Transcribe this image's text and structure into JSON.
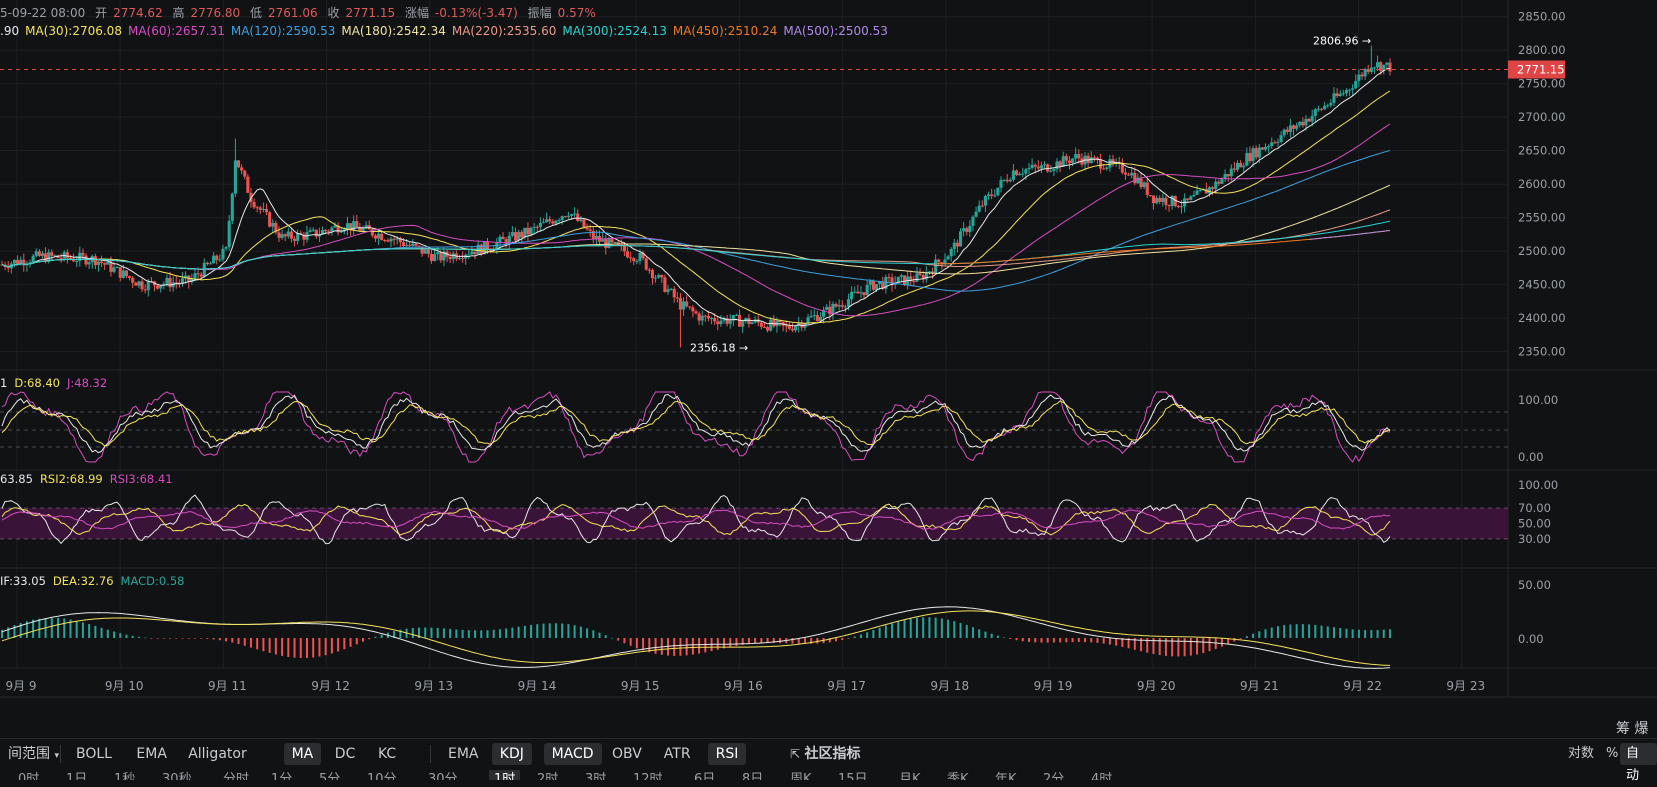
{
  "ohlc": {
    "date": "5-09-22 08:00",
    "open_label": "开",
    "open": "2774.62",
    "high_label": "高",
    "high": "2776.80",
    "low_label": "低",
    "low": "2761.06",
    "close_label": "收",
    "close": "2771.15",
    "change_label": "涨幅",
    "change": "-0.13%(-3.47)",
    "amp_label": "振幅",
    "amp": "0.57%"
  },
  "ma_legend": [
    {
      "text": ".90",
      "color": "#e8e8e8"
    },
    {
      "text": "MA(30):2706.08",
      "color": "#f5e35a"
    },
    {
      "text": "MA(60):2657.31",
      "color": "#d64dc1"
    },
    {
      "text": "MA(120):2590.53",
      "color": "#3ea0e0"
    },
    {
      "text": "MA(180):2542.34",
      "color": "#f0e4a0"
    },
    {
      "text": "MA(220):2535.60",
      "color": "#e89a8a"
    },
    {
      "text": "MA(300):2524.13",
      "color": "#28d3d3"
    },
    {
      "text": "MA(450):2510.24",
      "color": "#f07820"
    },
    {
      "text": "MA(500):2500.53",
      "color": "#b08ae8"
    }
  ],
  "kdj_legend": [
    {
      "text": "1",
      "color": "#e8e8e8"
    },
    {
      "text": "D:68.40",
      "color": "#f5e35a"
    },
    {
      "text": "J:48.32",
      "color": "#d64dc1"
    }
  ],
  "rsi_legend": [
    {
      "text": "63.85",
      "color": "#e8e8e8"
    },
    {
      "text": "RSI2:68.99",
      "color": "#f5e35a"
    },
    {
      "text": "RSI3:68.41",
      "color": "#d64dc1"
    }
  ],
  "macd_legend": [
    {
      "text": "IF:33.05",
      "color": "#e8e8e8"
    },
    {
      "text": "DEA:32.76",
      "color": "#f5e35a"
    },
    {
      "text": "MACD:0.58",
      "color": "#26a69a"
    }
  ],
  "price_axis": [
    "2850.00",
    "2800.00",
    "2750.00",
    "2700.00",
    "2650.00",
    "2600.00",
    "2550.00",
    "2500.00",
    "2450.00",
    "2400.00",
    "2350.00"
  ],
  "current_price": "2771.15",
  "high_marker": "2806.96 →",
  "low_marker": "2356.18 →",
  "kdj_axis": [
    "100.00",
    "0.00"
  ],
  "rsi_axis": [
    "100.00",
    "70.00",
    "50.00",
    "30.00"
  ],
  "macd_axis": [
    "50.00",
    "0.00"
  ],
  "time_axis": [
    "9月 9",
    "9月 10",
    "9月 11",
    "9月 12",
    "9月 13",
    "9月 14",
    "9月 15",
    "9月 16",
    "9月 17",
    "9月 18",
    "9月 19",
    "9月 20",
    "9月 21",
    "9月 22",
    "9月 23"
  ],
  "corner_label": "筹 爆",
  "toolbar": {
    "range_label": "间范围",
    "main_indicators": [
      {
        "label": "BOLL",
        "active": false
      },
      {
        "label": "EMA",
        "active": false
      },
      {
        "label": "Alligator",
        "active": false
      },
      {
        "label": "MA",
        "active": true
      },
      {
        "label": "DC",
        "active": false
      },
      {
        "label": "KC",
        "active": false
      }
    ],
    "sub_indicators": [
      {
        "label": "EMA",
        "active": false
      },
      {
        "label": "KDJ",
        "active": true
      },
      {
        "label": "MACD",
        "active": true
      },
      {
        "label": "OBV",
        "active": false
      },
      {
        "label": "ATR",
        "active": false
      },
      {
        "label": "RSI",
        "active": true
      }
    ],
    "community_label": "社区指标",
    "log_label": "对数",
    "percent_label": "%",
    "auto_label": "自动"
  },
  "timeframes": [
    "0时",
    "1日",
    "1秒",
    "30秒",
    "分时",
    "1分",
    "5分",
    "10分",
    "30分",
    "1时",
    "2时",
    "3时",
    "12时",
    "6日",
    "8日",
    "周K",
    "15日",
    "月K",
    "季K",
    "年K",
    "2分",
    "4时"
  ],
  "active_timeframe": "1时",
  "colors": {
    "up": "#26a69a",
    "down": "#ef5350",
    "bg": "#111214",
    "grid": "#1d1f22",
    "price_tag": "#e04545"
  },
  "chart_data": {
    "type": "candlestick",
    "x_range": [
      "9月 9",
      "9月 23"
    ],
    "y_range": [
      2330,
      2860
    ],
    "current_price": 2771.15,
    "high": 2806.96,
    "low": 2356.18,
    "price_path_keypoints": [
      [
        0,
        2480
      ],
      [
        12,
        2492
      ],
      [
        30,
        2488
      ],
      [
        45,
        2450
      ],
      [
        60,
        2455
      ],
      [
        72,
        2500
      ],
      [
        75,
        2640
      ],
      [
        80,
        2580
      ],
      [
        90,
        2520
      ],
      [
        100,
        2525
      ],
      [
        110,
        2540
      ],
      [
        125,
        2520
      ],
      [
        140,
        2490
      ],
      [
        155,
        2505
      ],
      [
        170,
        2530
      ],
      [
        182,
        2560
      ],
      [
        190,
        2520
      ],
      [
        205,
        2490
      ],
      [
        218,
        2420
      ],
      [
        225,
        2400
      ],
      [
        240,
        2395
      ],
      [
        252,
        2385
      ],
      [
        265,
        2410
      ],
      [
        280,
        2450
      ],
      [
        295,
        2460
      ],
      [
        305,
        2500
      ],
      [
        315,
        2570
      ],
      [
        325,
        2620
      ],
      [
        335,
        2625
      ],
      [
        345,
        2640
      ],
      [
        355,
        2630
      ],
      [
        362,
        2620
      ],
      [
        370,
        2580
      ],
      [
        380,
        2570
      ],
      [
        390,
        2600
      ],
      [
        400,
        2640
      ],
      [
        410,
        2670
      ],
      [
        420,
        2700
      ],
      [
        432,
        2740
      ],
      [
        440,
        2780
      ],
      [
        446,
        2775
      ]
    ],
    "ma_series": [
      "MA(30)",
      "MA(60)",
      "MA(120)",
      "MA(180)",
      "MA(220)",
      "MA(300)",
      "MA(450)",
      "MA(500)"
    ]
  }
}
